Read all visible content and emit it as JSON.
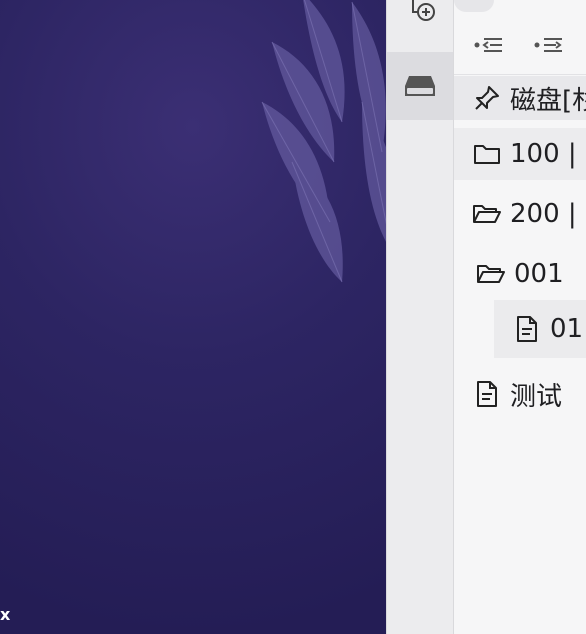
{
  "desktop": {
    "corner_text": "x"
  },
  "ribbon": {
    "items": [
      {
        "icon": "new-note-plus-icon"
      },
      {
        "icon": "disk-drive-icon"
      }
    ]
  },
  "sidebar": {
    "toolbar": [
      {
        "icon": "collapse-all-icon"
      },
      {
        "icon": "expand-all-icon"
      }
    ],
    "pinned": {
      "label": "磁盘[杉",
      "icon": "pin-icon"
    },
    "tree": [
      {
        "label": "100 |",
        "icon": "folder-icon"
      },
      {
        "label": "200 |",
        "icon": "folder-open-icon"
      },
      {
        "label": "001",
        "icon": "folder-open-icon"
      },
      {
        "label": "01",
        "icon": "file-icon"
      },
      {
        "label": "测试",
        "icon": "file-icon"
      }
    ]
  },
  "colors": {
    "wallpaper": "#2d2563",
    "ribbon_bg": "#ececee",
    "sidebar_bg": "#f6f6f7",
    "selected_bg": "#ebebed",
    "text": "#1f1f22"
  }
}
